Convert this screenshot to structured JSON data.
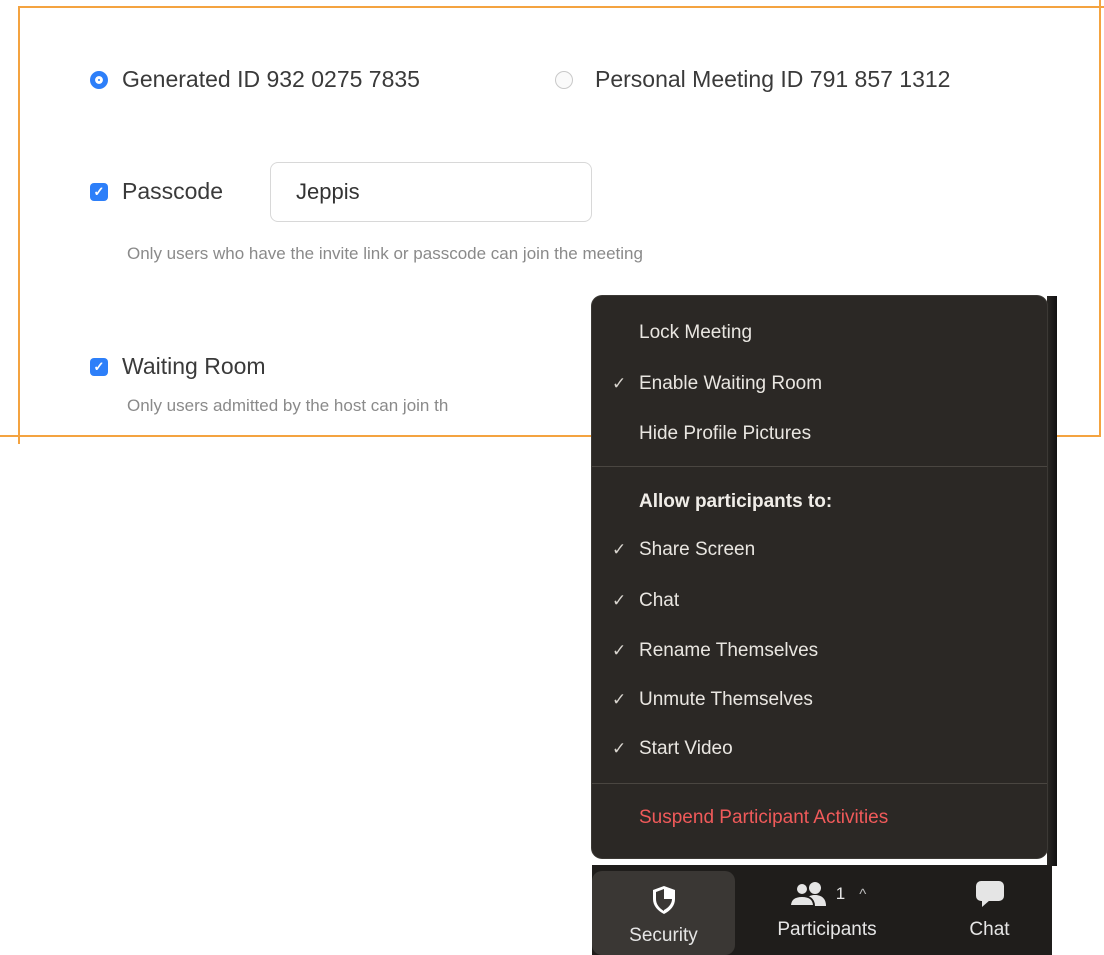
{
  "meeting_id": {
    "generated_label": "Generated ID 932 0275 7835",
    "personal_label": "Personal Meeting ID 791 857 1312"
  },
  "passcode": {
    "label": "Passcode",
    "value": "Jeppis",
    "hint": "Only users who have the invite link or passcode can join the meeting"
  },
  "waiting_room": {
    "label": "Waiting Room",
    "hint": "Only users admitted by the host can join th"
  },
  "security_menu": {
    "items": [
      {
        "label": "Lock Meeting",
        "checked": false
      },
      {
        "label": "Enable Waiting Room",
        "checked": true
      },
      {
        "label": "Hide Profile Pictures",
        "checked": false
      }
    ],
    "section_header": "Allow participants to:",
    "participant_items": [
      {
        "label": "Share Screen",
        "checked": true
      },
      {
        "label": "Chat",
        "checked": true
      },
      {
        "label": "Rename Themselves",
        "checked": true
      },
      {
        "label": "Unmute Themselves",
        "checked": true
      },
      {
        "label": "Start Video",
        "checked": true
      }
    ],
    "suspend_label": "Suspend Participant Activities",
    "check_glyph": "✓"
  },
  "toolbar": {
    "security_label": "Security",
    "participants_label": "Participants",
    "participants_count": "1",
    "caret": "^",
    "chat_label": "Chat"
  },
  "colors": {
    "accent_blue": "#2d7ff9",
    "border_orange": "#f4a340",
    "menu_bg": "#2b2825",
    "danger": "#f05a5a"
  }
}
